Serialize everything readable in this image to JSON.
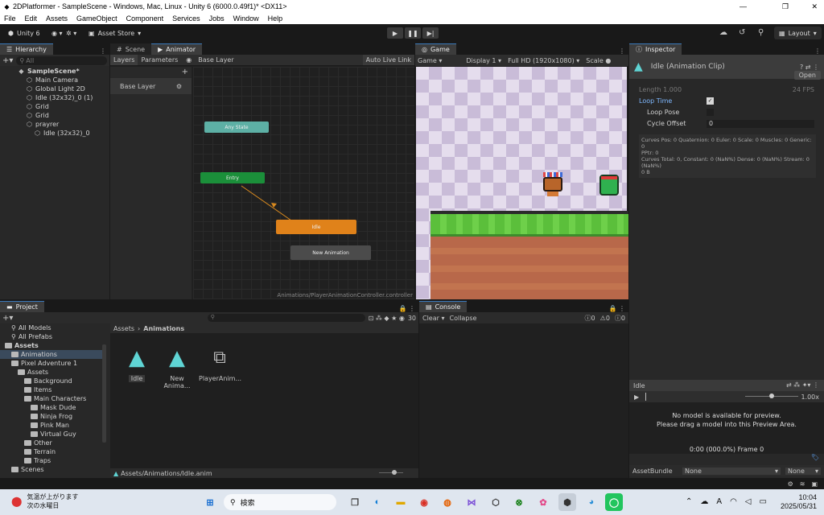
{
  "window": {
    "title": "2DPlatformer - SampleScene - Windows, Mac, Linux - Unity 6 (6000.0.49f1)* <DX11>",
    "min": "—",
    "max": "❐",
    "close": "✕"
  },
  "menu": [
    "File",
    "Edit",
    "Assets",
    "GameObject",
    "Component",
    "Services",
    "Jobs",
    "Window",
    "Help"
  ],
  "toolbar": {
    "unity": "Unity 6",
    "asset_store": "Asset Store",
    "layout": "Layout"
  },
  "hierarchy": {
    "tab": "Hierarchy",
    "search_placeholder": "All",
    "items": [
      {
        "label": "SampleScene*",
        "indent": 0,
        "bold": true
      },
      {
        "label": "Main Camera",
        "indent": 1
      },
      {
        "label": "Global Light 2D",
        "indent": 1
      },
      {
        "label": "Idle (32x32)_0 (1)",
        "indent": 1
      },
      {
        "label": "Grid",
        "indent": 1
      },
      {
        "label": "Grid",
        "indent": 1
      },
      {
        "label": "prayrer",
        "indent": 1
      },
      {
        "label": "Idle (32x32)_0",
        "indent": 2
      }
    ]
  },
  "scene_tab": "Scene",
  "animator": {
    "tab": "Animator",
    "layers": "Layers",
    "parameters": "Parameters",
    "breadcrumb": "Base Layer",
    "auto_live": "Auto Live Link",
    "layer_item": "Base Layer",
    "path": "Animations/PlayerAnimationController.controller",
    "nodes": {
      "any": "Any State",
      "entry": "Entry",
      "idle": "Idle",
      "new_anim": "New Animation"
    }
  },
  "game": {
    "tab": "Game",
    "mode": "Game",
    "display": "Display 1",
    "resolution": "Full HD (1920x1080)",
    "scale": "Scale"
  },
  "inspector": {
    "tab": "Inspector",
    "title": "Idle (Animation Clip)",
    "open": "Open",
    "length_label": "Length",
    "length_value": "1.000",
    "fps": "24 FPS",
    "loop_time": "Loop Time",
    "loop_pose": "Loop Pose",
    "cycle_offset": "Cycle Offset",
    "cycle_value": "0",
    "info": [
      "Curves Pos: 0 Quaternion: 0 Euler: 0 Scale: 0 Muscles: 0 Generic: 0",
      "PPtr: 0",
      "Curves Total: 0, Constant: 0 (NaN%) Dense: 0 (NaN%) Stream: 0",
      "(NaN%)",
      "0 B"
    ],
    "preview_title": "Idle",
    "preview_speed": "1.00x",
    "no_model": "No model is available for preview.",
    "drag_hint": "Please drag a model into this Preview Area.",
    "frame": "0:00 (000.0%) Frame 0",
    "asset_bundle": "AssetBundle",
    "bundle_value": "None",
    "bundle_variant": "None"
  },
  "project": {
    "tab": "Project",
    "breadcrumb_root": "Assets",
    "breadcrumb_leaf": "Animations",
    "count": "30",
    "footer_path": "Assets/Animations/Idle.anim",
    "tree": [
      {
        "label": "All Models",
        "indent": 1,
        "kind": "search"
      },
      {
        "label": "All Prefabs",
        "indent": 1,
        "kind": "search"
      },
      {
        "label": "Assets",
        "indent": 0,
        "kind": "folder",
        "bold": true
      },
      {
        "label": "Animations",
        "indent": 1,
        "kind": "folder",
        "selected": true
      },
      {
        "label": "Pixel Adventure 1",
        "indent": 1,
        "kind": "folder"
      },
      {
        "label": "Assets",
        "indent": 2,
        "kind": "folder"
      },
      {
        "label": "Background",
        "indent": 3,
        "kind": "folder"
      },
      {
        "label": "Items",
        "indent": 3,
        "kind": "folder"
      },
      {
        "label": "Main Characters",
        "indent": 3,
        "kind": "folder"
      },
      {
        "label": "Mask Dude",
        "indent": 4,
        "kind": "folder"
      },
      {
        "label": "Ninja Frog",
        "indent": 4,
        "kind": "folder"
      },
      {
        "label": "Pink Man",
        "indent": 4,
        "kind": "folder"
      },
      {
        "label": "Virtual Guy",
        "indent": 4,
        "kind": "folder"
      },
      {
        "label": "Other",
        "indent": 3,
        "kind": "folder"
      },
      {
        "label": "Terrain",
        "indent": 3,
        "kind": "folder"
      },
      {
        "label": "Traps",
        "indent": 3,
        "kind": "folder"
      },
      {
        "label": "Scenes",
        "indent": 1,
        "kind": "folder"
      }
    ],
    "assets": [
      {
        "label": "Idle",
        "icon": "animation-clip-icon"
      },
      {
        "label": "New Anima...",
        "icon": "animation-clip-icon"
      },
      {
        "label": "PlayerAnim...",
        "icon": "animator-controller-icon"
      }
    ]
  },
  "console": {
    "tab": "Console",
    "clear": "Clear",
    "collapse": "Collapse",
    "errors": "0",
    "warnings": "0",
    "logs": "0"
  },
  "taskbar": {
    "weather_line1": "気温が上がります",
    "weather_line2": "次の水曜日",
    "search": "検索",
    "time": "10:04",
    "date": "2025/05/31",
    "ime": "A"
  },
  "colors": {
    "accent": "#3a79bb",
    "entry": "#1b8f3a",
    "idle": "#e0821a",
    "any": "#5db0a5",
    "anim_icon": "#5fd4d4"
  }
}
